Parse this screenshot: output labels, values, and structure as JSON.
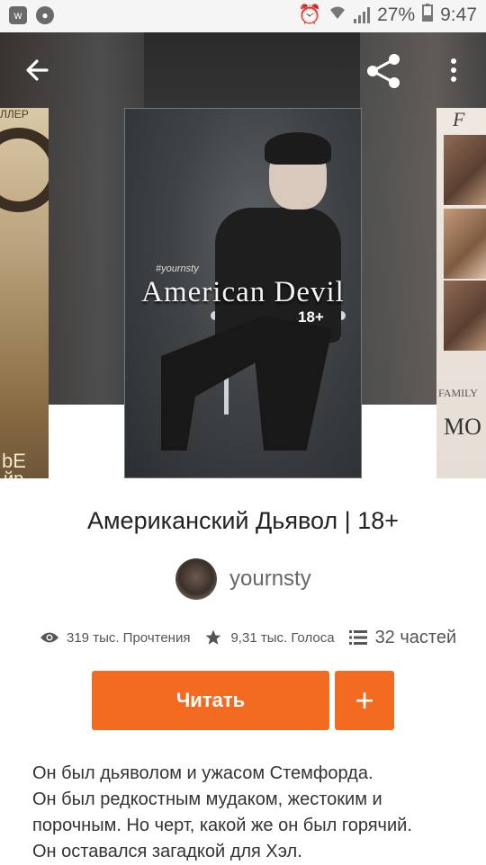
{
  "status_bar": {
    "battery": "27%",
    "time": "9:47"
  },
  "cover": {
    "author_tag": "#yournsty",
    "title": "American Devil",
    "age": "18+"
  },
  "side_cover_left": {
    "top_text": "ЛЛЕР",
    "big_text": "bE",
    "bottom_text": "йр"
  },
  "side_cover_right": {
    "letter": "F",
    "family": "FAMILY",
    "mo": "MO"
  },
  "story": {
    "title": "Американский Дьявол | 18+",
    "author": "yournsty"
  },
  "stats": {
    "reads": "319 тыс. Прочтения",
    "votes": "9,31 тыс. Голоса",
    "parts": "32 частей"
  },
  "actions": {
    "read_label": "Читать",
    "add_label": "+"
  },
  "description": [
    "Он был дьяволом и ужасом Стемфорда.",
    "Он был редкостным мудаком, жестоким и",
    "порочным. Но черт, какой же он был горячий.",
    "Он оставался загадкой для Хэл."
  ],
  "colors": {
    "accent": "#f26b21"
  }
}
